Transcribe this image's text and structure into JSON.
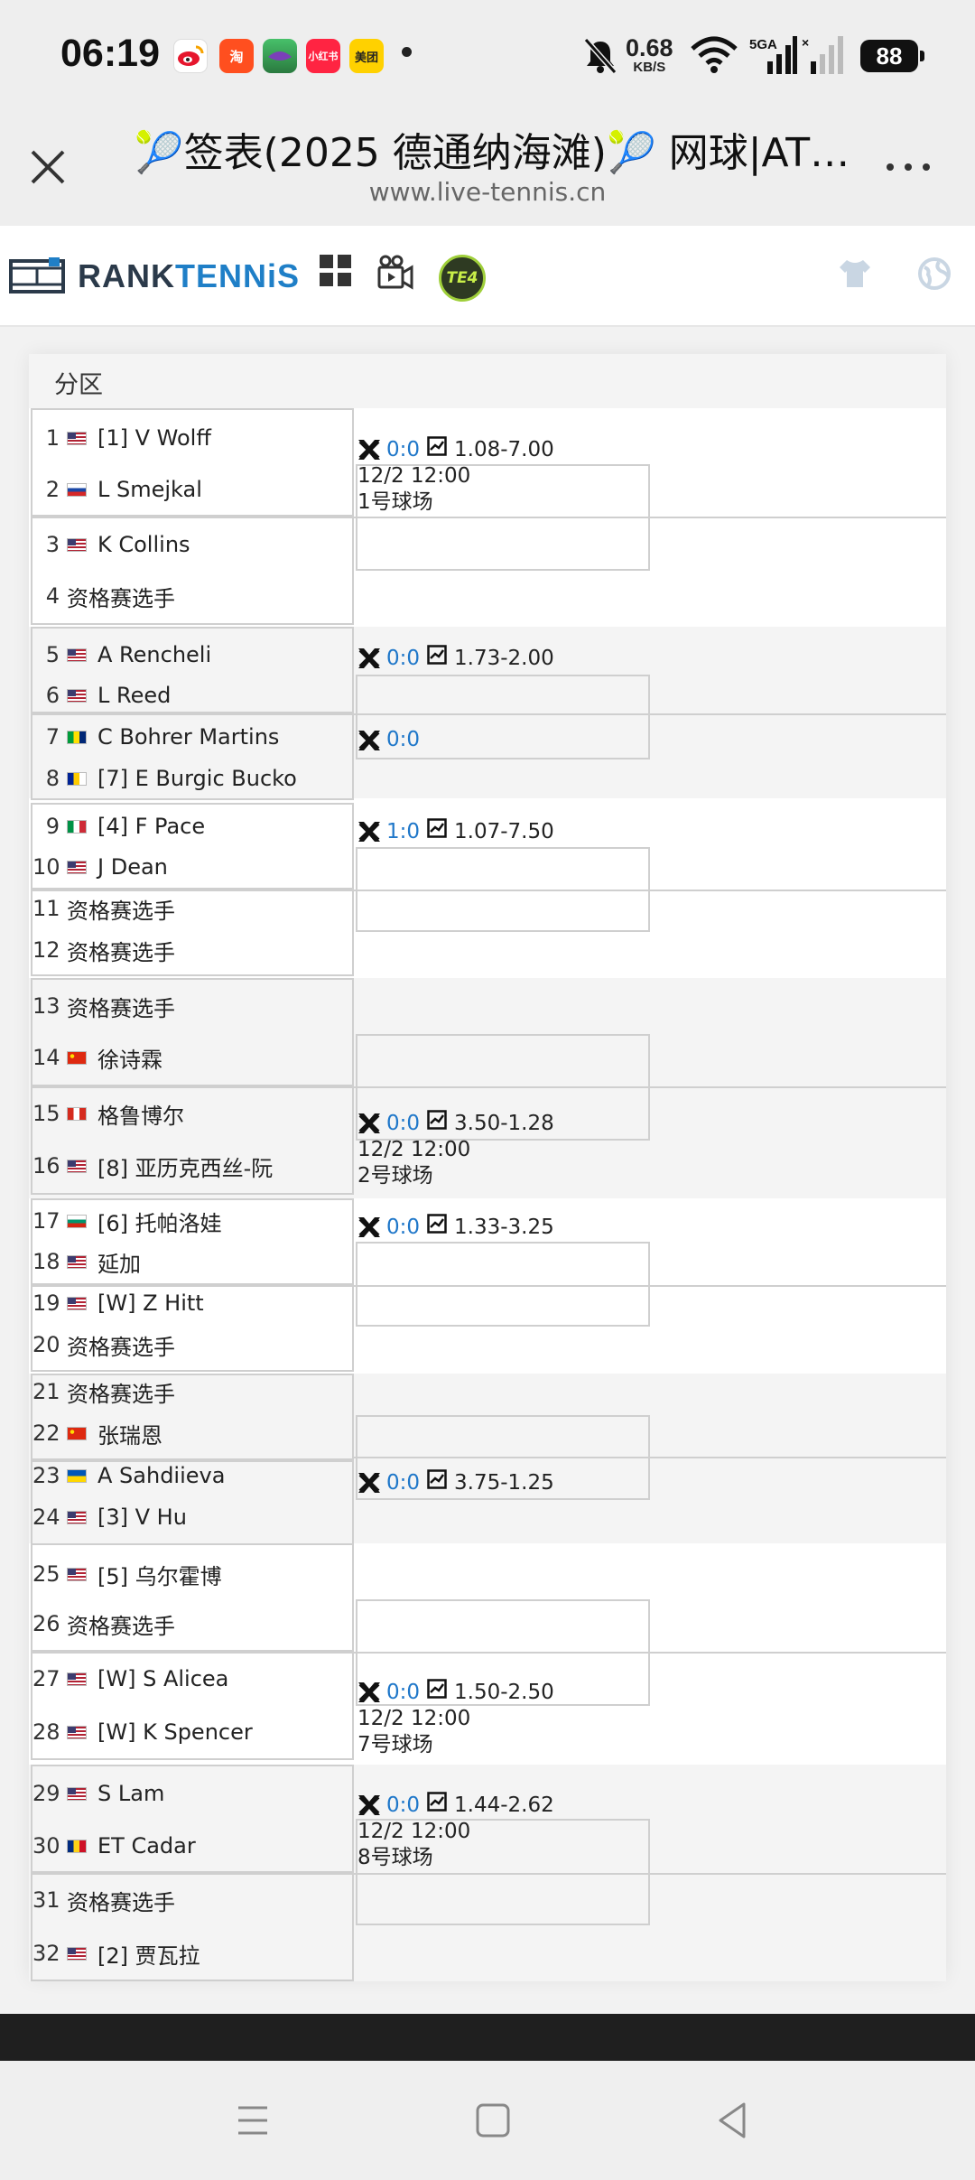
{
  "status_bar": {
    "time": "06:19",
    "apps": [
      {
        "name": "weibo-icon",
        "label": "",
        "color": "#ffffff"
      },
      {
        "name": "taobao-icon",
        "label": "淘",
        "color": "#ff4f1f"
      },
      {
        "name": "game-app-icon",
        "label": "",
        "color": "#2fa84f"
      },
      {
        "name": "xiaohongshu-icon",
        "label": "小红书",
        "color": "#ff2442"
      },
      {
        "name": "meituan-icon",
        "label": "美团",
        "color": "#ffd100"
      }
    ],
    "net_speed_value": "0.68",
    "net_speed_unit": "KB/S",
    "signal_label": "5GA",
    "battery": "88"
  },
  "browser": {
    "title": "🎾签表(2025 德通纳海滩)🎾 网球|AT…",
    "url": "www.live-tennis.cn"
  },
  "site_nav": {
    "logo_part1": "RANK",
    "logo_part2": "TENNiS",
    "te4_label": "TE4"
  },
  "section": {
    "label": "分区"
  },
  "groups": [
    {
      "players": [
        {
          "seed": "1",
          "flag": "us",
          "name": "[1] V Wolff"
        },
        {
          "seed": "2",
          "flag": "si",
          "name": "L Smejkal"
        },
        {
          "seed": "3",
          "flag": "us",
          "name": "K Collins"
        },
        {
          "seed": "4",
          "flag": "",
          "name": "资格赛选手"
        }
      ],
      "matches": [
        {
          "h2h": "0:0",
          "odds": "1.08-7.00",
          "time": "12/2 12:00",
          "court": "1号球场"
        }
      ]
    },
    {
      "players": [
        {
          "seed": "5",
          "flag": "us",
          "name": "A Rencheli"
        },
        {
          "seed": "6",
          "flag": "us",
          "name": "L Reed"
        },
        {
          "seed": "7",
          "flag": "br",
          "name": "C Bohrer Martins"
        },
        {
          "seed": "8",
          "flag": "ba",
          "name": "[7] E Burgic Bucko"
        }
      ],
      "matches": [
        {
          "h2h": "0:0",
          "odds": "1.73-2.00",
          "time": "",
          "court": ""
        },
        {
          "h2h": "0:0",
          "odds": "",
          "time": "",
          "court": ""
        }
      ]
    },
    {
      "players": [
        {
          "seed": "9",
          "flag": "it",
          "name": "[4] F Pace"
        },
        {
          "seed": "10",
          "flag": "us",
          "name": "J Dean"
        },
        {
          "seed": "11",
          "flag": "",
          "name": "资格赛选手"
        },
        {
          "seed": "12",
          "flag": "",
          "name": "资格赛选手"
        }
      ],
      "matches": [
        {
          "h2h": "1:0",
          "odds": "1.07-7.50",
          "time": "",
          "court": ""
        }
      ]
    },
    {
      "players": [
        {
          "seed": "13",
          "flag": "",
          "name": "资格赛选手"
        },
        {
          "seed": "14",
          "flag": "cn",
          "name": "徐诗霖"
        },
        {
          "seed": "15",
          "flag": "ca",
          "name": "格鲁博尔"
        },
        {
          "seed": "16",
          "flag": "us",
          "name": "[8] 亚历克西丝-阮"
        }
      ],
      "matches": [
        {
          "h2h": "0:0",
          "odds": "3.50-1.28",
          "time": "12/2 12:00",
          "court": "2号球场"
        }
      ]
    },
    {
      "players": [
        {
          "seed": "17",
          "flag": "bg",
          "name": "[6] 托帕洛娃"
        },
        {
          "seed": "18",
          "flag": "us",
          "name": "延加"
        },
        {
          "seed": "19",
          "flag": "us",
          "name": "[W] Z Hitt"
        },
        {
          "seed": "20",
          "flag": "",
          "name": "资格赛选手"
        }
      ],
      "matches": [
        {
          "h2h": "0:0",
          "odds": "1.33-3.25",
          "time": "",
          "court": ""
        }
      ]
    },
    {
      "players": [
        {
          "seed": "21",
          "flag": "",
          "name": "资格赛选手"
        },
        {
          "seed": "22",
          "flag": "cn",
          "name": "张瑞恩"
        },
        {
          "seed": "23",
          "flag": "ua",
          "name": "A Sahdiieva"
        },
        {
          "seed": "24",
          "flag": "us",
          "name": "[3] V Hu"
        }
      ],
      "matches": [
        {
          "h2h": "0:0",
          "odds": "3.75-1.25",
          "time": "",
          "court": ""
        }
      ]
    },
    {
      "players": [
        {
          "seed": "25",
          "flag": "us",
          "name": "[5] 乌尔霍博"
        },
        {
          "seed": "26",
          "flag": "",
          "name": "资格赛选手"
        },
        {
          "seed": "27",
          "flag": "us",
          "name": "[W] S Alicea"
        },
        {
          "seed": "28",
          "flag": "us",
          "name": "[W] K Spencer"
        }
      ],
      "matches": [
        {
          "h2h": "0:0",
          "odds": "1.50-2.50",
          "time": "12/2 12:00",
          "court": "7号球场"
        }
      ]
    },
    {
      "players": [
        {
          "seed": "29",
          "flag": "us",
          "name": "S Lam"
        },
        {
          "seed": "30",
          "flag": "ro",
          "name": "ET Cadar"
        },
        {
          "seed": "31",
          "flag": "",
          "name": "资格赛选手"
        },
        {
          "seed": "32",
          "flag": "us",
          "name": "[2] 贾瓦拉"
        }
      ],
      "matches": [
        {
          "h2h": "0:0",
          "odds": "1.44-2.62",
          "time": "12/2 12:00",
          "court": "8号球场"
        }
      ]
    }
  ]
}
